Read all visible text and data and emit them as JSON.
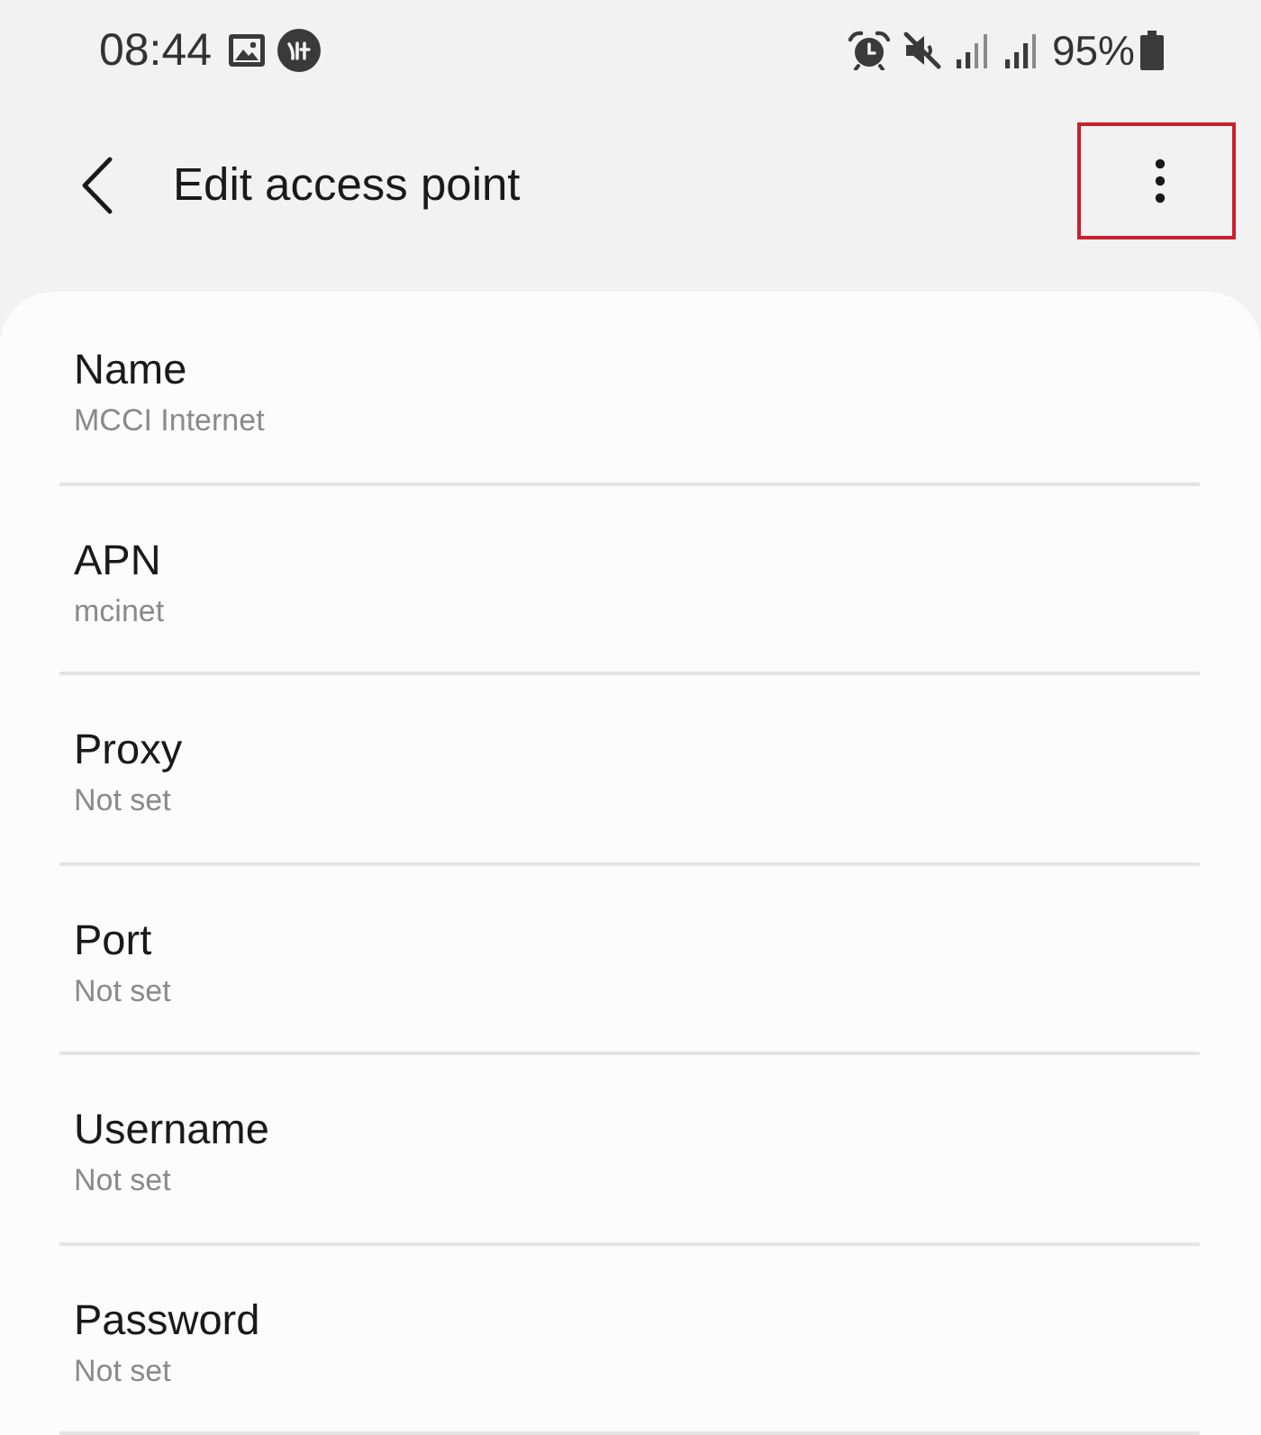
{
  "status_bar": {
    "time": "08:44",
    "battery": "95%"
  },
  "header": {
    "title": "Edit access point"
  },
  "fields": [
    {
      "label": "Name",
      "value": "MCCI Internet"
    },
    {
      "label": "APN",
      "value": "mcinet"
    },
    {
      "label": "Proxy",
      "value": "Not set"
    },
    {
      "label": "Port",
      "value": "Not set"
    },
    {
      "label": "Username",
      "value": "Not set"
    },
    {
      "label": "Password",
      "value": "Not set"
    }
  ]
}
